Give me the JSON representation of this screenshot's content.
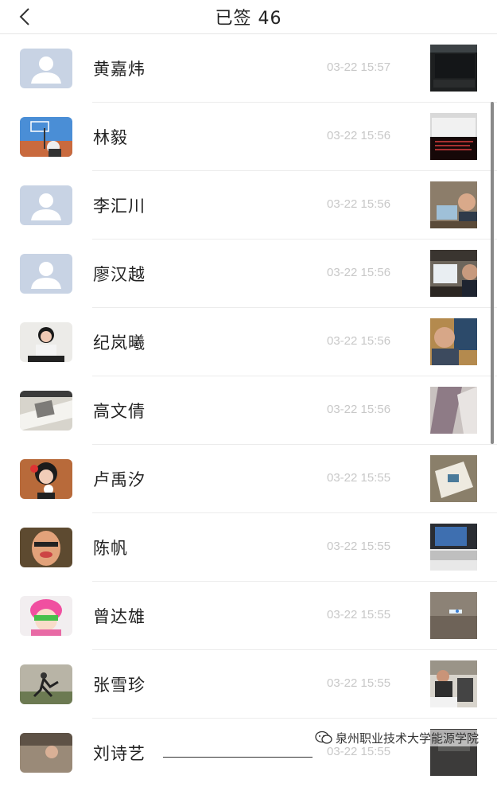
{
  "header": {
    "title": "已签 46"
  },
  "rows": [
    {
      "name": "黄嘉炜",
      "time": "03-22 15:57",
      "avatar": "default",
      "photo": "dark-screen"
    },
    {
      "name": "林毅",
      "time": "03-22 15:56",
      "avatar": "basketball",
      "photo": "red-screen"
    },
    {
      "name": "李汇川",
      "time": "03-22 15:56",
      "avatar": "default",
      "photo": "desk-person"
    },
    {
      "name": "廖汉越",
      "time": "03-22 15:56",
      "avatar": "default",
      "photo": "monitor"
    },
    {
      "name": "纪岚曦",
      "time": "03-22 15:56",
      "avatar": "portrait",
      "photo": "selfie"
    },
    {
      "name": "高文倩",
      "time": "03-22 15:56",
      "avatar": "paper",
      "photo": "blur"
    },
    {
      "name": "卢禹汐",
      "time": "03-22 15:55",
      "avatar": "girl-flower",
      "photo": "desk-book"
    },
    {
      "name": "陈帆",
      "time": "03-22 15:55",
      "avatar": "funny-face",
      "photo": "laptop"
    },
    {
      "name": "曾达雄",
      "time": "03-22 15:55",
      "avatar": "anime",
      "photo": "light"
    },
    {
      "name": "张雪珍",
      "time": "03-22 15:55",
      "avatar": "dance",
      "photo": "classroom"
    },
    {
      "name": "刘诗艺",
      "time": "03-22 15:55",
      "avatar": "outdoor",
      "photo": "dark"
    }
  ],
  "watermark": {
    "text": "泉州职业技术大学能源学院",
    "icon": "wechat-icon"
  }
}
